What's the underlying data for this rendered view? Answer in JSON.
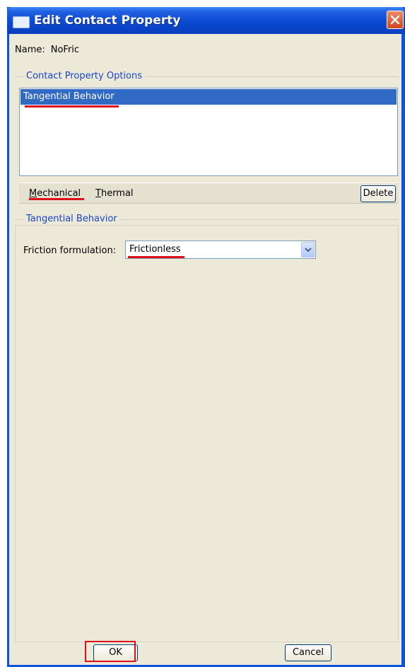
{
  "window": {
    "title": "Edit Contact Property"
  },
  "name_field": {
    "label": "Name:",
    "value": "NoFric"
  },
  "options_group": {
    "title": "Contact Property Options",
    "items": [
      {
        "label": "Tangential Behavior",
        "selected": true
      }
    ]
  },
  "menu": {
    "items": [
      {
        "label": "Mechanical",
        "underline": "M"
      },
      {
        "label": "Thermal",
        "underline": "T"
      }
    ],
    "delete_label": "Delete"
  },
  "behavior_group": {
    "title": "Tangential Behavior",
    "friction_label": "Friction formulation:",
    "friction_value": "Frictionless"
  },
  "buttons": {
    "ok": "OK",
    "cancel": "Cancel"
  },
  "colors": {
    "selection": "#316ac5",
    "annotation": "#e0101a",
    "group_title": "#1a46c8"
  }
}
